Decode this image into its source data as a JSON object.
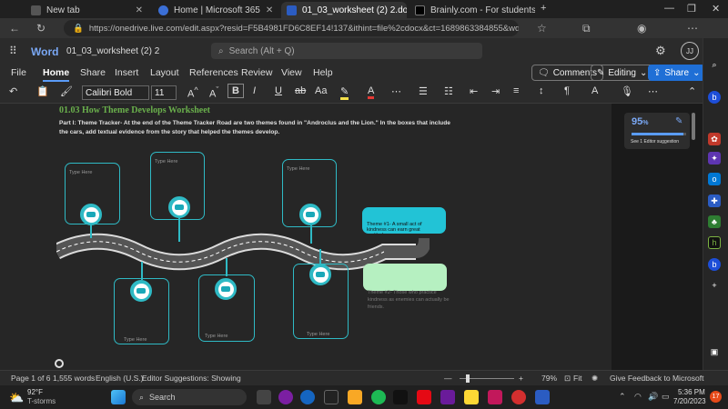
{
  "browser": {
    "tabs": [
      {
        "label": "New tab",
        "active": false
      },
      {
        "label": "Home | Microsoft 365",
        "active": false
      },
      {
        "label": "01_03_worksheet (2) 2.docx - Mi",
        "active": true
      },
      {
        "label": "Brainly.com - For students. By stu",
        "active": false
      }
    ],
    "new_tab": "+",
    "url": "https://onedrive.live.com/edit.aspx?resid=F5B4981FD6C8EF14!137&ithint=file%2cdocx&ct=1689863384855&wdOrigin=..."
  },
  "word": {
    "app_name": "Word",
    "doc_name": "01_03_worksheet (2) 2",
    "search_placeholder": "Search (Alt + Q)",
    "avatar_initials": "JJ",
    "menu": [
      "File",
      "Home",
      "Share",
      "Insert",
      "Layout",
      "References",
      "Review",
      "View",
      "Help"
    ],
    "active_menu": "Home",
    "comments_label": "Comments",
    "editing_label": "Editing",
    "share_label": "Share",
    "font_name": "Calibri Bold",
    "font_size": "11"
  },
  "document": {
    "title": "01.03 How Theme Develops Worksheet",
    "part1": "Part I: Theme Tracker- At the end of the Theme Tracker Road are two themes found in \"Androclus and the Lion.\" In the boxes that include the cars, add textual evidence from the story that helped the themes develop.",
    "boxes_top": [
      "Type Here",
      "Type Here",
      "Type Here"
    ],
    "boxes_bottom": [
      "Type Here",
      "Type Here",
      "Type Here"
    ],
    "theme1": "Theme #1- A small act of kindness can earn great gratitude.",
    "theme2": "Theme #2- Those who practice kindness earn a true friendship, as enemies can actually be friends.",
    "theme2_visible": "Theme #2- Those who practice kindness as enemies can actually be friends."
  },
  "editor": {
    "score": "95",
    "score_pct_symbol": "%",
    "score_fraction": 0.95,
    "label": "See 1 Editor suggestion"
  },
  "status": {
    "page": "Page 1 of 6",
    "words": "1,555 words",
    "language": "English (U.S.)",
    "editor": "Editor Suggestions: Showing",
    "zoom": "79%",
    "fit": "Fit",
    "feedback": "Give Feedback to Microsoft"
  },
  "taskbar": {
    "weather_temp": "92°F",
    "weather_desc": "T-storms",
    "search": "Search",
    "time": "5:36 PM",
    "date": "7/20/2023",
    "notif_count": "17"
  }
}
